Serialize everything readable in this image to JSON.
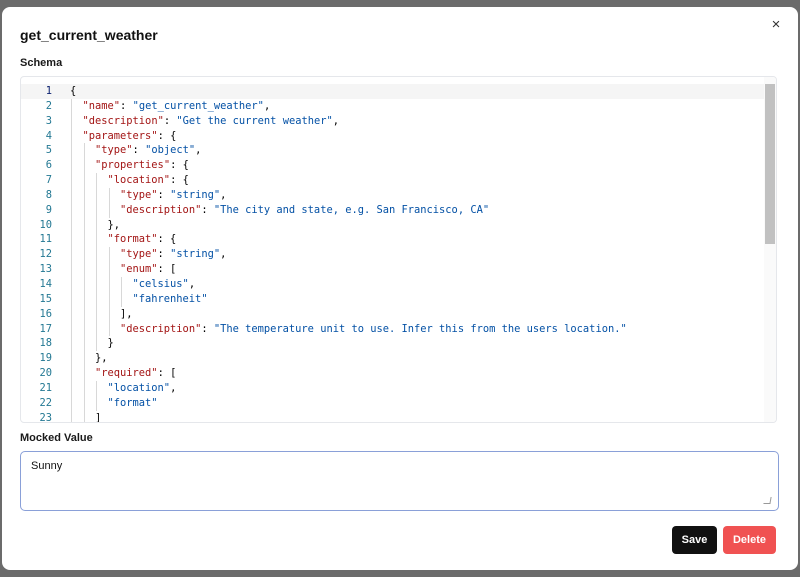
{
  "dialog": {
    "title": "get_current_weather",
    "close_icon": "×",
    "schema_label": "Schema",
    "mocked_label": "Mocked Value",
    "mocked_value": "Sunny",
    "save_label": "Save",
    "delete_label": "Delete"
  },
  "colors": {
    "key": "#a31515",
    "string": "#0451a5",
    "line_number": "#237893",
    "save_button": "#111111",
    "delete_button": "#f05252"
  },
  "code_lines": [
    {
      "n": "1",
      "indent": 0,
      "parts": [
        [
          "p",
          "{"
        ]
      ]
    },
    {
      "n": "2",
      "indent": 1,
      "parts": [
        [
          "k",
          "\"name\""
        ],
        [
          "p",
          ": "
        ],
        [
          "s",
          "\"get_current_weather\""
        ],
        [
          "p",
          ","
        ]
      ]
    },
    {
      "n": "3",
      "indent": 1,
      "parts": [
        [
          "k",
          "\"description\""
        ],
        [
          "p",
          ": "
        ],
        [
          "s",
          "\"Get the current weather\""
        ],
        [
          "p",
          ","
        ]
      ]
    },
    {
      "n": "4",
      "indent": 1,
      "parts": [
        [
          "k",
          "\"parameters\""
        ],
        [
          "p",
          ": {"
        ]
      ]
    },
    {
      "n": "5",
      "indent": 2,
      "parts": [
        [
          "k",
          "\"type\""
        ],
        [
          "p",
          ": "
        ],
        [
          "s",
          "\"object\""
        ],
        [
          "p",
          ","
        ]
      ]
    },
    {
      "n": "6",
      "indent": 2,
      "parts": [
        [
          "k",
          "\"properties\""
        ],
        [
          "p",
          ": {"
        ]
      ]
    },
    {
      "n": "7",
      "indent": 3,
      "parts": [
        [
          "k",
          "\"location\""
        ],
        [
          "p",
          ": {"
        ]
      ]
    },
    {
      "n": "8",
      "indent": 4,
      "parts": [
        [
          "k",
          "\"type\""
        ],
        [
          "p",
          ": "
        ],
        [
          "s",
          "\"string\""
        ],
        [
          "p",
          ","
        ]
      ]
    },
    {
      "n": "9",
      "indent": 4,
      "parts": [
        [
          "k",
          "\"description\""
        ],
        [
          "p",
          ": "
        ],
        [
          "s",
          "\"The city and state, e.g. San Francisco, CA\""
        ]
      ]
    },
    {
      "n": "10",
      "indent": 3,
      "parts": [
        [
          "p",
          "},"
        ]
      ]
    },
    {
      "n": "11",
      "indent": 3,
      "parts": [
        [
          "k",
          "\"format\""
        ],
        [
          "p",
          ": {"
        ]
      ]
    },
    {
      "n": "12",
      "indent": 4,
      "parts": [
        [
          "k",
          "\"type\""
        ],
        [
          "p",
          ": "
        ],
        [
          "s",
          "\"string\""
        ],
        [
          "p",
          ","
        ]
      ]
    },
    {
      "n": "13",
      "indent": 4,
      "parts": [
        [
          "k",
          "\"enum\""
        ],
        [
          "p",
          ": ["
        ]
      ]
    },
    {
      "n": "14",
      "indent": 5,
      "parts": [
        [
          "s",
          "\"celsius\""
        ],
        [
          "p",
          ","
        ]
      ]
    },
    {
      "n": "15",
      "indent": 5,
      "parts": [
        [
          "s",
          "\"fahrenheit\""
        ]
      ]
    },
    {
      "n": "16",
      "indent": 4,
      "parts": [
        [
          "p",
          "],"
        ]
      ]
    },
    {
      "n": "17",
      "indent": 4,
      "parts": [
        [
          "k",
          "\"description\""
        ],
        [
          "p",
          ": "
        ],
        [
          "s",
          "\"The temperature unit to use. Infer this from the users location.\""
        ]
      ]
    },
    {
      "n": "18",
      "indent": 3,
      "parts": [
        [
          "p",
          "}"
        ]
      ]
    },
    {
      "n": "19",
      "indent": 2,
      "parts": [
        [
          "p",
          "},"
        ]
      ]
    },
    {
      "n": "20",
      "indent": 2,
      "parts": [
        [
          "k",
          "\"required\""
        ],
        [
          "p",
          ": ["
        ]
      ]
    },
    {
      "n": "21",
      "indent": 3,
      "parts": [
        [
          "s",
          "\"location\""
        ],
        [
          "p",
          ","
        ]
      ]
    },
    {
      "n": "22",
      "indent": 3,
      "parts": [
        [
          "s",
          "\"format\""
        ]
      ]
    },
    {
      "n": "23",
      "indent": 2,
      "parts": [
        [
          "p",
          "]"
        ]
      ]
    }
  ]
}
